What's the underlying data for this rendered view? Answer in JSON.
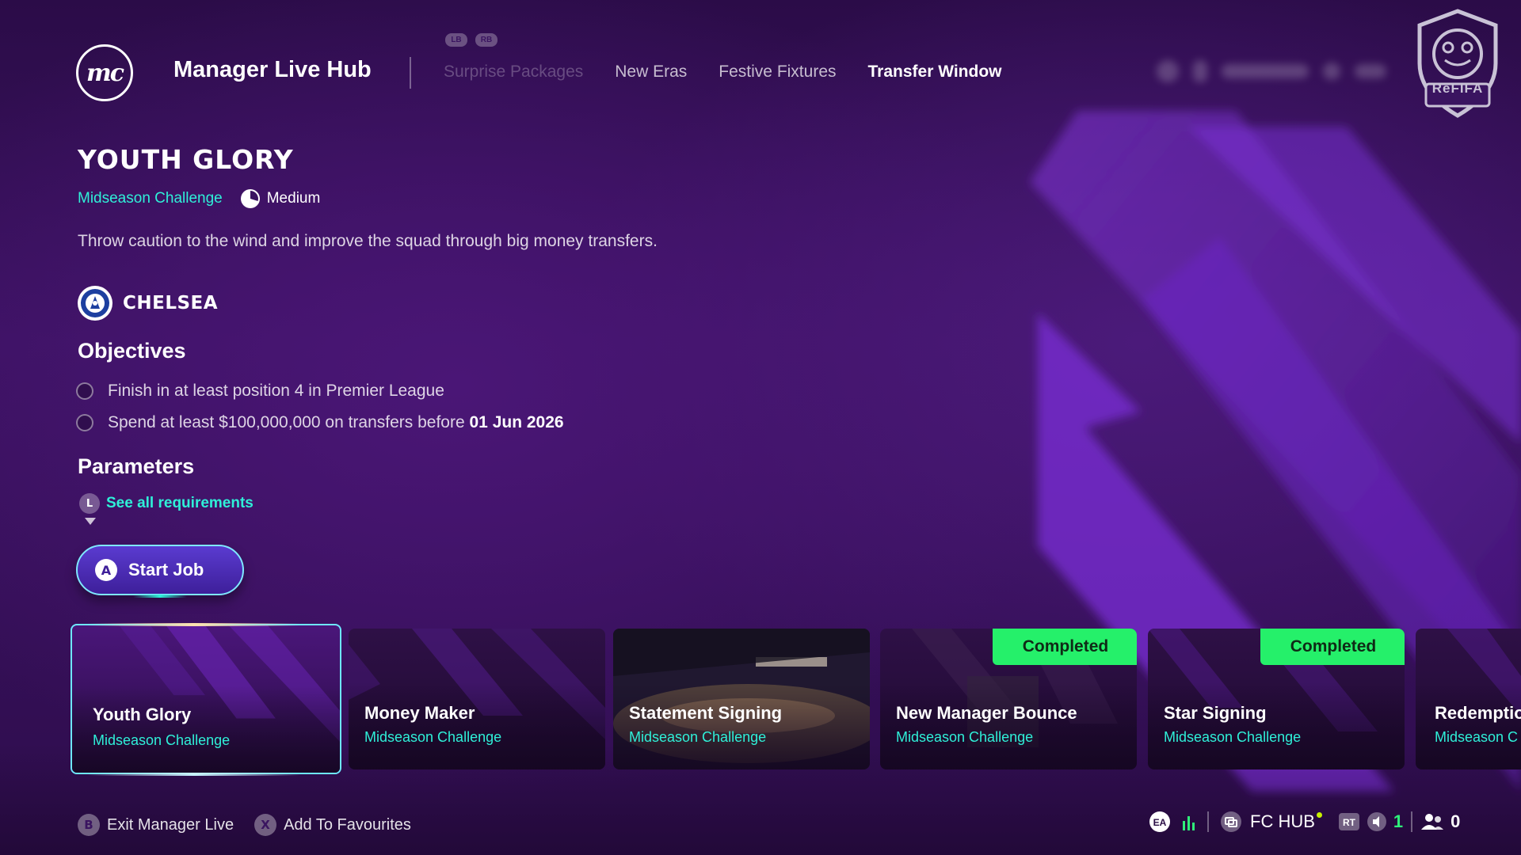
{
  "header": {
    "logo_text": "mc",
    "title": "Manager Live Hub",
    "bumpers": [
      "LB",
      "RB"
    ],
    "tabs": [
      {
        "label": "Surprise Packages",
        "state": "faded"
      },
      {
        "label": "New Eras",
        "state": "normal"
      },
      {
        "label": "Festive Fixtures",
        "state": "normal"
      },
      {
        "label": "Transfer Window",
        "state": "active"
      }
    ],
    "watermark_text": "ReFIFA"
  },
  "job": {
    "title": "YOUTH GLORY",
    "type": "Midseason Challenge",
    "difficulty": "Medium",
    "description": "Throw caution to the wind and improve the squad through big money transfers.",
    "club": "CHELSEA",
    "club_crest_text": "CHELSEA"
  },
  "objectives": {
    "heading": "Objectives",
    "items": [
      {
        "text": "Finish in at least position 4 in Premier League",
        "bold": ""
      },
      {
        "text": "Spend at least $100,000,000 on transfers before ",
        "bold": "01 Jun 2026"
      }
    ]
  },
  "parameters": {
    "heading": "Parameters",
    "button": "L",
    "link": "See all requirements"
  },
  "start_button": {
    "icon": "A",
    "label": "Start Job"
  },
  "cards": [
    {
      "title": "Youth Glory",
      "subtitle": "Midseason Challenge",
      "completed": false,
      "selected": true
    },
    {
      "title": "Money Maker",
      "subtitle": "Midseason Challenge",
      "completed": false,
      "selected": false
    },
    {
      "title": "Statement Signing",
      "subtitle": "Midseason Challenge",
      "completed": false,
      "selected": false
    },
    {
      "title": "New Manager Bounce",
      "subtitle": "Midseason Challenge",
      "completed": true,
      "selected": false
    },
    {
      "title": "Star Signing",
      "subtitle": "Midseason Challenge",
      "completed": true,
      "selected": false
    },
    {
      "title": "Redemptio",
      "subtitle": "Midseason C",
      "completed": false,
      "selected": false
    }
  ],
  "completed_label": "Completed",
  "footer": {
    "actions": [
      {
        "button": "B",
        "label": "Exit Manager Live"
      },
      {
        "button": "X",
        "label": "Add To Favourites"
      }
    ],
    "status": {
      "ea_label": "EA",
      "hub_label": "FC HUB",
      "rt_label": "RT",
      "count_one": "1",
      "count_two": "0"
    }
  },
  "colors": {
    "accent_cyan": "#2ff0d8",
    "completed_green": "#25f06a",
    "bg_purple": "#2a0d45",
    "stripe_purple": "#7a2fd6"
  }
}
